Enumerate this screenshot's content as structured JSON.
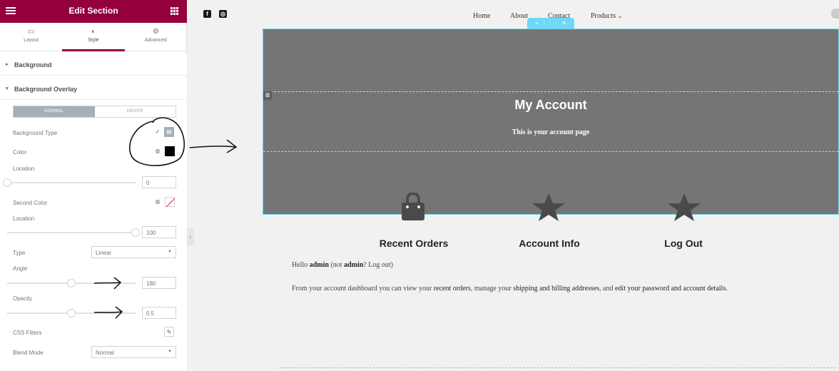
{
  "panel": {
    "title": "Edit Section",
    "tabs": [
      {
        "label": "Layout",
        "icon": "layout-icon"
      },
      {
        "label": "Style",
        "icon": "style-icon"
      },
      {
        "label": "Advanced",
        "icon": "gear-icon"
      }
    ],
    "active_tab": "Style",
    "sections": {
      "background": "Background",
      "background_overlay": "Background Overlay"
    },
    "state_toggle": {
      "normal": "NORMAL",
      "hover": "HOVER",
      "active": "NORMAL"
    },
    "fields": {
      "background_type": "Background Type",
      "color": "Color",
      "location": "Location",
      "location_value": "0",
      "location_level": 0,
      "second_color": "Second Color",
      "second_location": "Location",
      "second_location_value": "100",
      "second_location_level": 100,
      "type": "Type",
      "type_value": "Linear",
      "angle": "Angle",
      "angle_value": "180",
      "angle_level": 0.5,
      "opacity": "Opacity",
      "opacity_value": "0.5",
      "opacity_level": 0.5,
      "css_filters": "CSS Filters",
      "blend_mode": "Blend Mode",
      "blend_mode_value": "Normal"
    },
    "colors": {
      "brand": "#93003c",
      "color_swatch": "#000000"
    }
  },
  "preview": {
    "nav": [
      "Home",
      "About",
      "Contact",
      "Products"
    ],
    "hero_title": "My Account",
    "hero_subtitle": "This is your account page",
    "features": [
      {
        "label": "Recent Orders",
        "icon": "shopping-bag-icon"
      },
      {
        "label": "Account Info",
        "icon": "star-icon"
      },
      {
        "label": "Log Out",
        "icon": "star-icon"
      }
    ],
    "greeting": {
      "hello": "Hello ",
      "user": "admin",
      "not": " (not ",
      "user2": "admin",
      "q": "? ",
      "logout": "Log out",
      "close": ")"
    },
    "dashboard": {
      "t1": "From your account dashboard you can view your ",
      "l1": "recent orders",
      "t2": ", manage your ",
      "l2": "shipping and billing addresses",
      "t3": ", and ",
      "l3": "edit your password and account details",
      "t4": "."
    },
    "colors": {
      "hero_bg": "#757575",
      "selection": "#71d7f7"
    }
  }
}
